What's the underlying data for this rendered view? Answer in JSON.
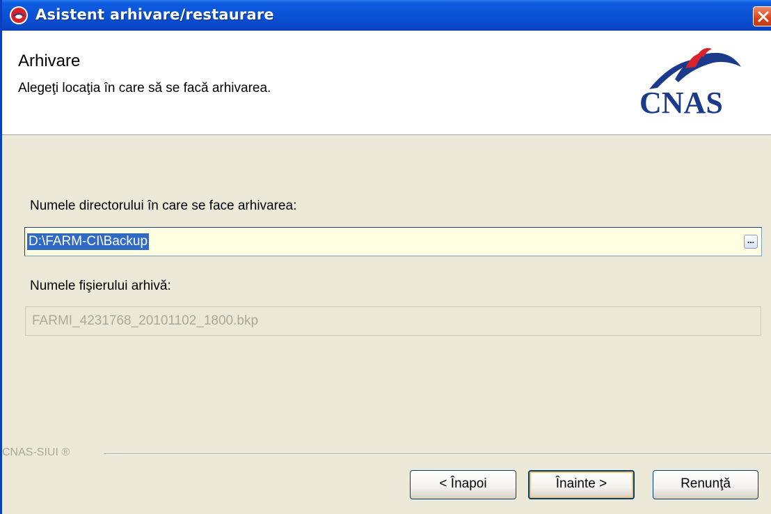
{
  "window": {
    "title": "Asistent arhivare/restaurare"
  },
  "header": {
    "title": "Arhivare",
    "subtitle": "Alegeţi locaţia în care să se facă arhivarea.",
    "logo_text": "CNAS"
  },
  "form": {
    "dir_label": "Numele directorului în care se face arhivarea:",
    "dir_value": "D:\\FARM-CI\\Backup",
    "browse_label": "...",
    "file_label": "Numele fişierului arhivă:",
    "file_value": "FARMI_4231768_20101102_1800.bkp"
  },
  "footer": {
    "brand": "CNAS-SIUI ®",
    "back_label": "< Înapoi",
    "next_label": "Înainte >",
    "cancel_label": "Renunţă"
  },
  "colors": {
    "titlebar": "#0a52d6",
    "selection": "#316ac5",
    "input_bg": "#ffffe1",
    "logo_blue": "#1b3a8c",
    "logo_red": "#d8232a"
  }
}
